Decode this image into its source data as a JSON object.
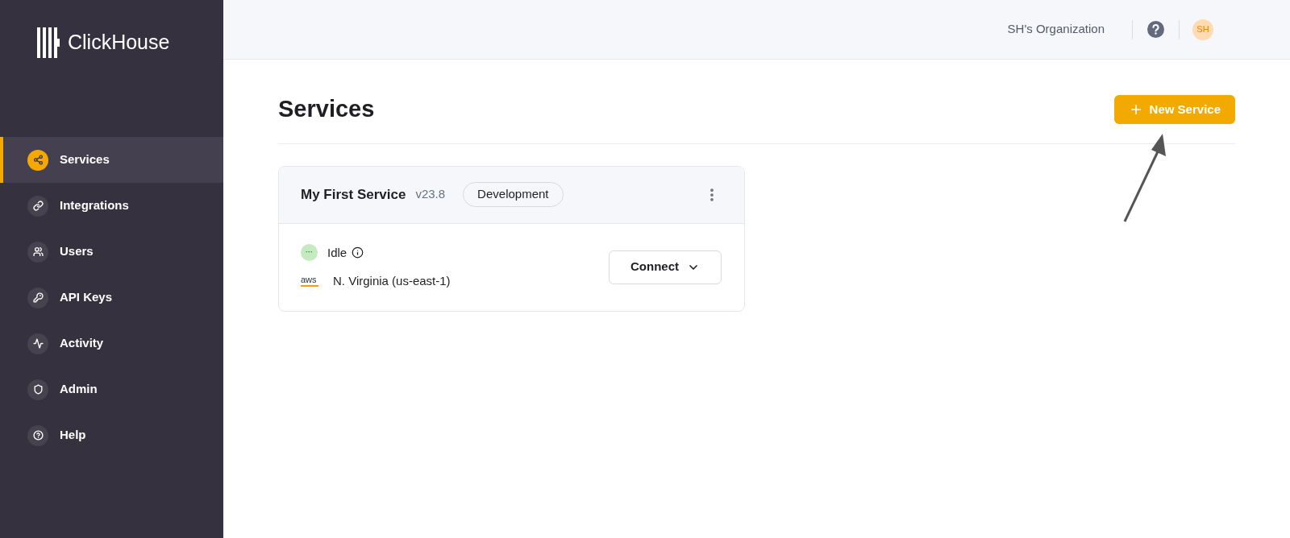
{
  "sidebar": {
    "logo": "ClickHouse",
    "items": [
      {
        "label": "Services",
        "selected": true
      },
      {
        "label": "Integrations",
        "selected": false
      },
      {
        "label": "Users",
        "selected": false
      },
      {
        "label": "API Keys",
        "selected": false
      },
      {
        "label": "Activity",
        "selected": false
      },
      {
        "label": "Admin",
        "selected": false
      },
      {
        "label": "Help",
        "selected": false
      }
    ]
  },
  "header": {
    "organization": "SH's Organization",
    "avatar": "SH"
  },
  "page": {
    "title": "Services",
    "new_button": "New Service"
  },
  "service_card": {
    "name": "My First Service",
    "version": "v23.8",
    "tag": "Development",
    "status": "Idle",
    "status_badge": "···",
    "provider_logo": "aws",
    "region": "N. Virginia (us-east-1)",
    "connect_button": "Connect"
  }
}
